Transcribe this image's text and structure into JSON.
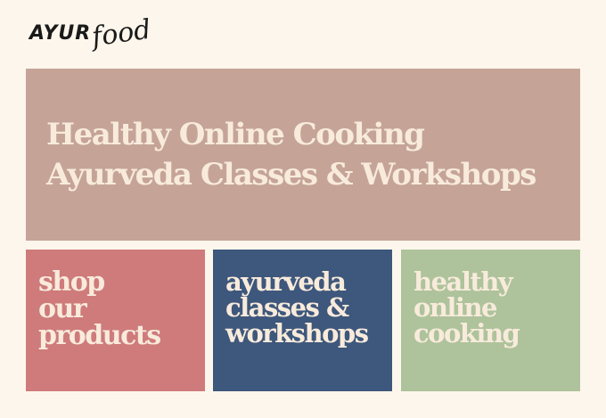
{
  "logo": {
    "caps": "AYUR",
    "script": "food"
  },
  "hero": {
    "lines": [
      "Healthy Online Cooking",
      "Ayurveda Classes & Workshops"
    ]
  },
  "tiles": [
    {
      "lines": [
        "shop",
        "our",
        "products"
      ],
      "color": "#cf7b7b"
    },
    {
      "lines": [
        "ayurveda",
        "classes &",
        "workshops"
      ],
      "color": "#3e577c"
    },
    {
      "lines": [
        "healthy",
        "online",
        "cooking"
      ],
      "color": "#aec39b"
    }
  ],
  "colors": {
    "background": "#fdf6ec",
    "hero": "#c5a497",
    "text_light": "#f8ebdc"
  }
}
